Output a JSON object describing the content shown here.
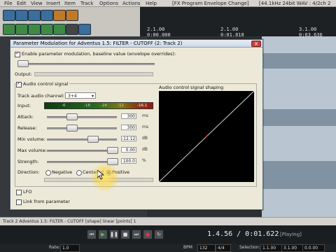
{
  "menubar": {
    "items": [
      "File",
      "Edit",
      "View",
      "Insert",
      "Item",
      "Track",
      "Options",
      "Actions",
      "Help"
    ],
    "project_title": "[FX Program Envelope Change]",
    "format_info": "[44.1kHz 24bit WAV : 4/2ch 2"
  },
  "timeline": {
    "markers": [
      {
        "bar": "2.1.00",
        "time": "0:00.000"
      },
      {
        "bar": "2.1.00",
        "time": "0:01.818"
      },
      {
        "bar": "3.1.00",
        "time": "0:03.636"
      }
    ]
  },
  "dialog": {
    "title": "Parameter Modulation for Adventus 1.5: FILTER - CUTOFF (2: Track 2)",
    "close_label": "X",
    "enable_label": "Enable parameter modulation, baseline value (envelope overrides):",
    "output_label": "Output:",
    "audio_control_label": "Audio control signal",
    "track_channel_label": "Track audio channel:",
    "track_channel_value": "3+4",
    "shaping_label": "Audio control signal shaping",
    "input_label": "Input:",
    "meter_ticks": [
      "-6",
      "-18",
      "-24",
      "-12",
      "-16.1"
    ],
    "attack": {
      "label": "Attack:",
      "value": "300",
      "unit": "ms"
    },
    "release": {
      "label": "Release:",
      "value": "300",
      "unit": "ms"
    },
    "min_volume": {
      "label": "Min volume:",
      "value": "-12.12",
      "unit": "dB"
    },
    "max_volume": {
      "label": "Max volume:",
      "value": "0.00",
      "unit": "dB"
    },
    "strength": {
      "label": "Strength:",
      "value": "100.0",
      "unit": "%"
    },
    "direction_label": "Direction:",
    "direction_options": [
      "Negative",
      "Centered",
      "Positive"
    ],
    "direction_selected": "Positive",
    "lfo_label": "LFO",
    "link_label": "Link from parameter"
  },
  "status": {
    "line": "Track 2 Adventus 1.5: FILTER - CUTOFF [shape] linear [points] 1"
  },
  "transport": {
    "position": "1.4.56 / 0:01.622",
    "state": "[Playing]"
  },
  "bottombar": {
    "rate_label": "Rate:",
    "rate_value": "1.0",
    "bpm_label": "BPM",
    "bpm_value": "132",
    "sig_value": "4/4",
    "selection_label": "Selection:",
    "sel_start": "1.1.00",
    "sel_end": "3.1.00",
    "sel_len": "0.0.00"
  },
  "colors": {
    "accent": "#1a4d9c",
    "graph_line": "#d0d0d0",
    "close": "#c8423a"
  }
}
